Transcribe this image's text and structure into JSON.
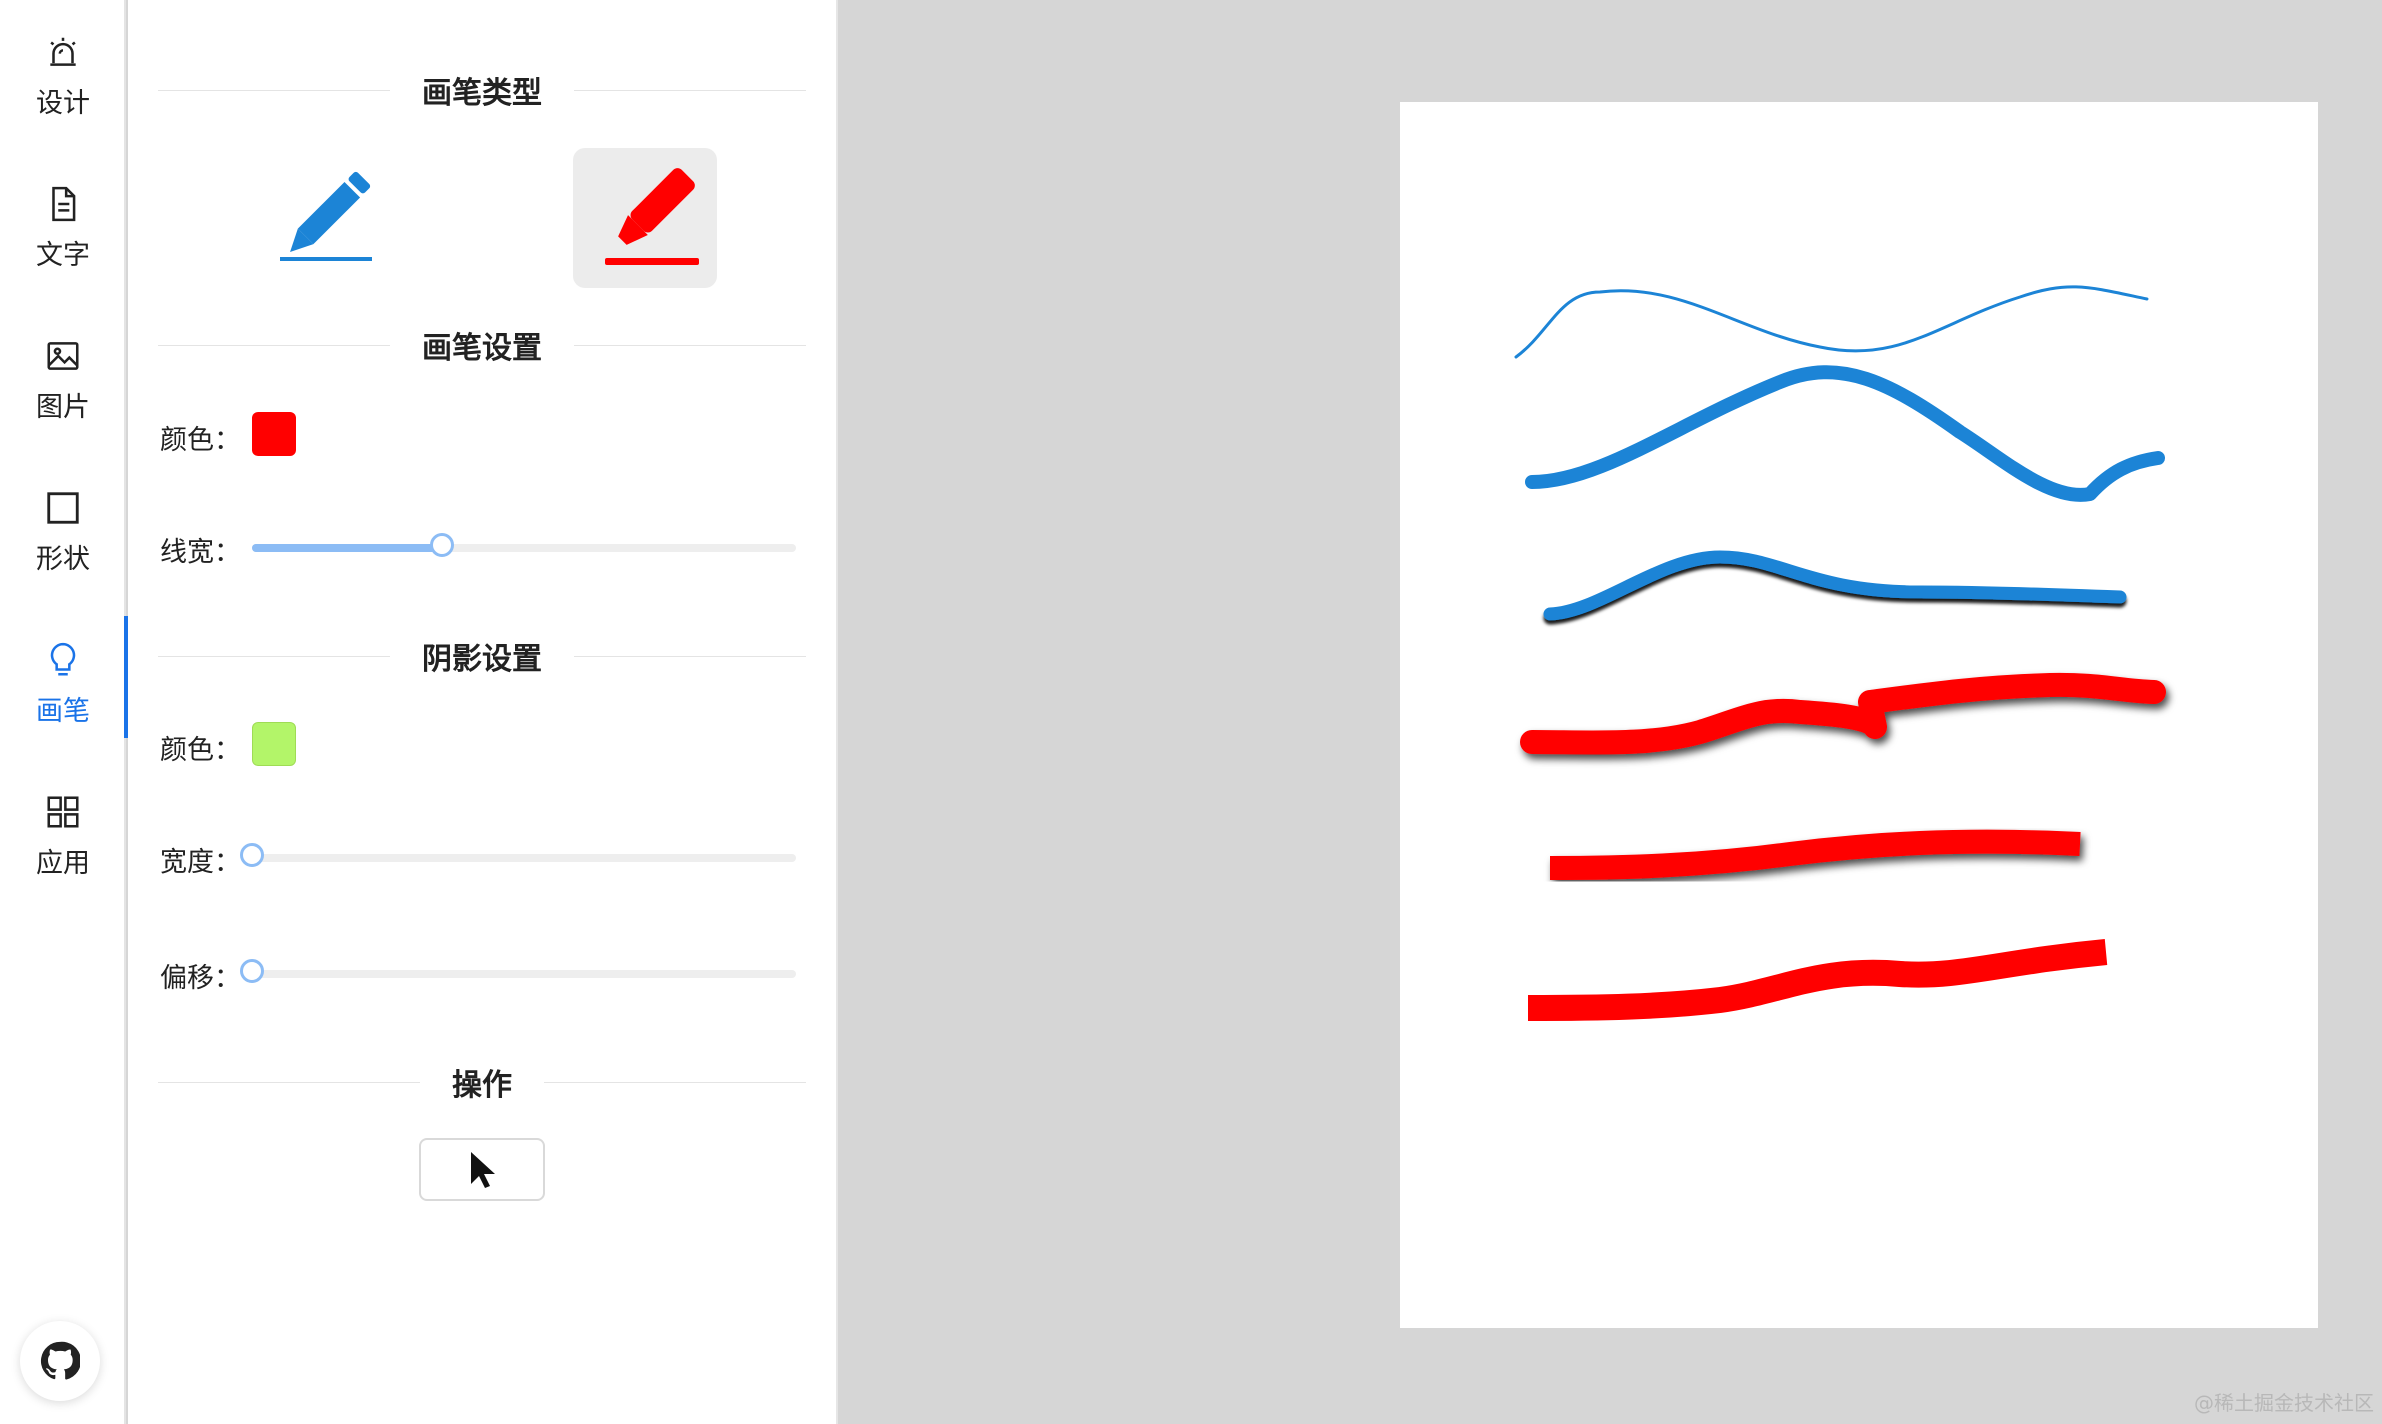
{
  "rail": {
    "items": [
      {
        "label": "设计",
        "icon": "siren-icon",
        "active": false
      },
      {
        "label": "文字",
        "icon": "document-icon",
        "active": false
      },
      {
        "label": "图片",
        "icon": "image-icon",
        "active": false
      },
      {
        "label": "形状",
        "icon": "square-icon",
        "active": false
      },
      {
        "label": "画笔",
        "icon": "bulb-icon",
        "active": true
      },
      {
        "label": "应用",
        "icon": "grid-icon",
        "active": false
      }
    ],
    "github_icon": "github-icon"
  },
  "panel": {
    "brush_type": {
      "title": "画笔类型",
      "tools": [
        {
          "icon": "pencil-icon",
          "color": "#1c84d6",
          "selected": false
        },
        {
          "icon": "marker-icon",
          "color": "#ff0000",
          "selected": true
        }
      ]
    },
    "brush_settings": {
      "title": "画笔设置",
      "color_label": "颜色：",
      "color": "#ff0000",
      "width_label": "线宽：",
      "width_fraction": 0.35
    },
    "shadow_settings": {
      "title": "阴影设置",
      "color_label": "颜色：",
      "color": "#b3f569",
      "width_label": "宽度：",
      "width_fraction": 0,
      "offset_label": "偏移：",
      "offset_fraction": 0
    },
    "actions": {
      "title": "操作",
      "select_icon": "cursor-icon"
    }
  },
  "canvas": {
    "background": "#d6d6d6",
    "paper_color": "#ffffff",
    "stroke_colors": [
      "#1c84d6",
      "#ff0000"
    ],
    "shadow_color": "#000000"
  },
  "watermark": "@稀土掘金技术社区"
}
